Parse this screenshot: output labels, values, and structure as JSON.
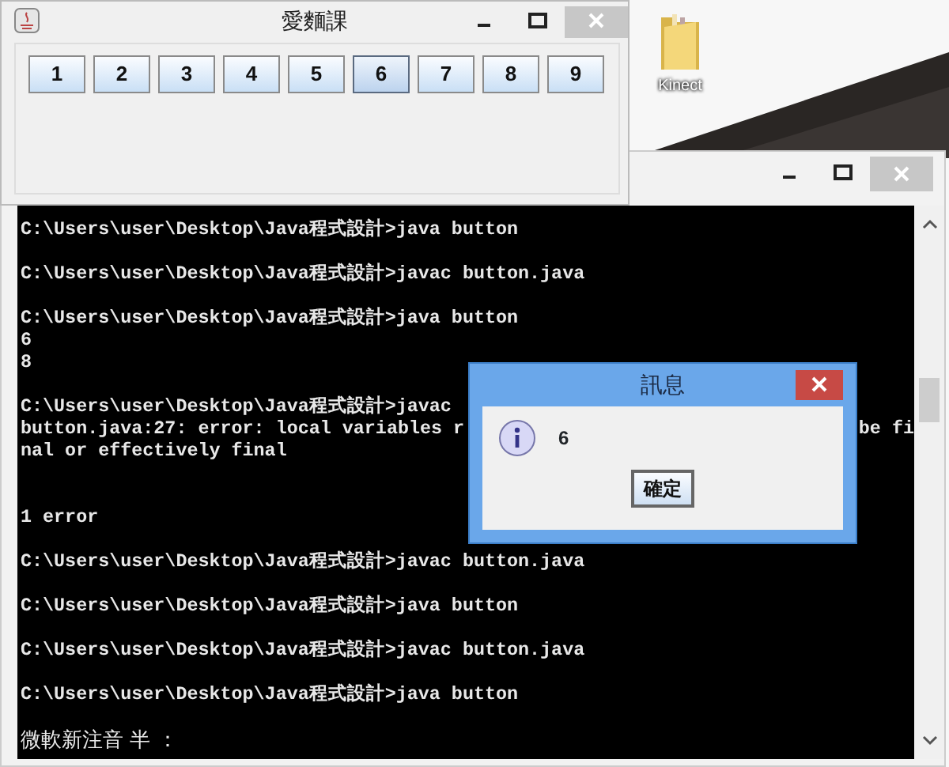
{
  "desktop": {
    "icons": [
      {
        "label": "Kinect"
      }
    ]
  },
  "java_window": {
    "title": "愛麵課",
    "buttons": [
      {
        "label": "1",
        "selected": false
      },
      {
        "label": "2",
        "selected": false
      },
      {
        "label": "3",
        "selected": false
      },
      {
        "label": "4",
        "selected": false
      },
      {
        "label": "5",
        "selected": false
      },
      {
        "label": "6",
        "selected": true
      },
      {
        "label": "7",
        "selected": false
      },
      {
        "label": "8",
        "selected": false
      },
      {
        "label": "9",
        "selected": false
      }
    ]
  },
  "console": {
    "lines": [
      {
        "text": "C:\\Users\\user\\Desktop\\Java程式設計>java button",
        "blank_before": false,
        "blank_after": true
      },
      {
        "text": "C:\\Users\\user\\Desktop\\Java程式設計>javac button.java",
        "blank_before": false,
        "blank_after": true
      },
      {
        "text": "C:\\Users\\user\\Desktop\\Java程式設計>java button",
        "blank_before": false,
        "blank_after": false
      },
      {
        "text": "6",
        "blank_before": false,
        "blank_after": false
      },
      {
        "text": "8",
        "blank_before": false,
        "blank_after": true
      },
      {
        "text": "C:\\Users\\user\\Desktop\\Java程式設計>javac",
        "blank_before": false,
        "blank_after": false
      },
      {
        "text": "button.java:27: error: local variables r",
        "tail": "be fi",
        "blank_before": false,
        "blank_after": false
      },
      {
        "text": "nal or effectively final",
        "blank_before": false,
        "blank_after": true
      },
      {
        "text": "1 error",
        "blank_before": true,
        "blank_after": true
      },
      {
        "text": "C:\\Users\\user\\Desktop\\Java程式設計>javac button.java",
        "blank_before": false,
        "blank_after": true
      },
      {
        "text": "C:\\Users\\user\\Desktop\\Java程式設計>java button",
        "blank_before": false,
        "blank_after": true
      },
      {
        "text": "C:\\Users\\user\\Desktop\\Java程式設計>javac button.java",
        "blank_before": false,
        "blank_after": true
      },
      {
        "text": "C:\\Users\\user\\Desktop\\Java程式設計>java button",
        "blank_before": false,
        "blank_after": true
      }
    ],
    "ime_status": "微軟新注音 半 ："
  },
  "dialog": {
    "title": "訊息",
    "message": "6",
    "ok_button": "確定"
  }
}
